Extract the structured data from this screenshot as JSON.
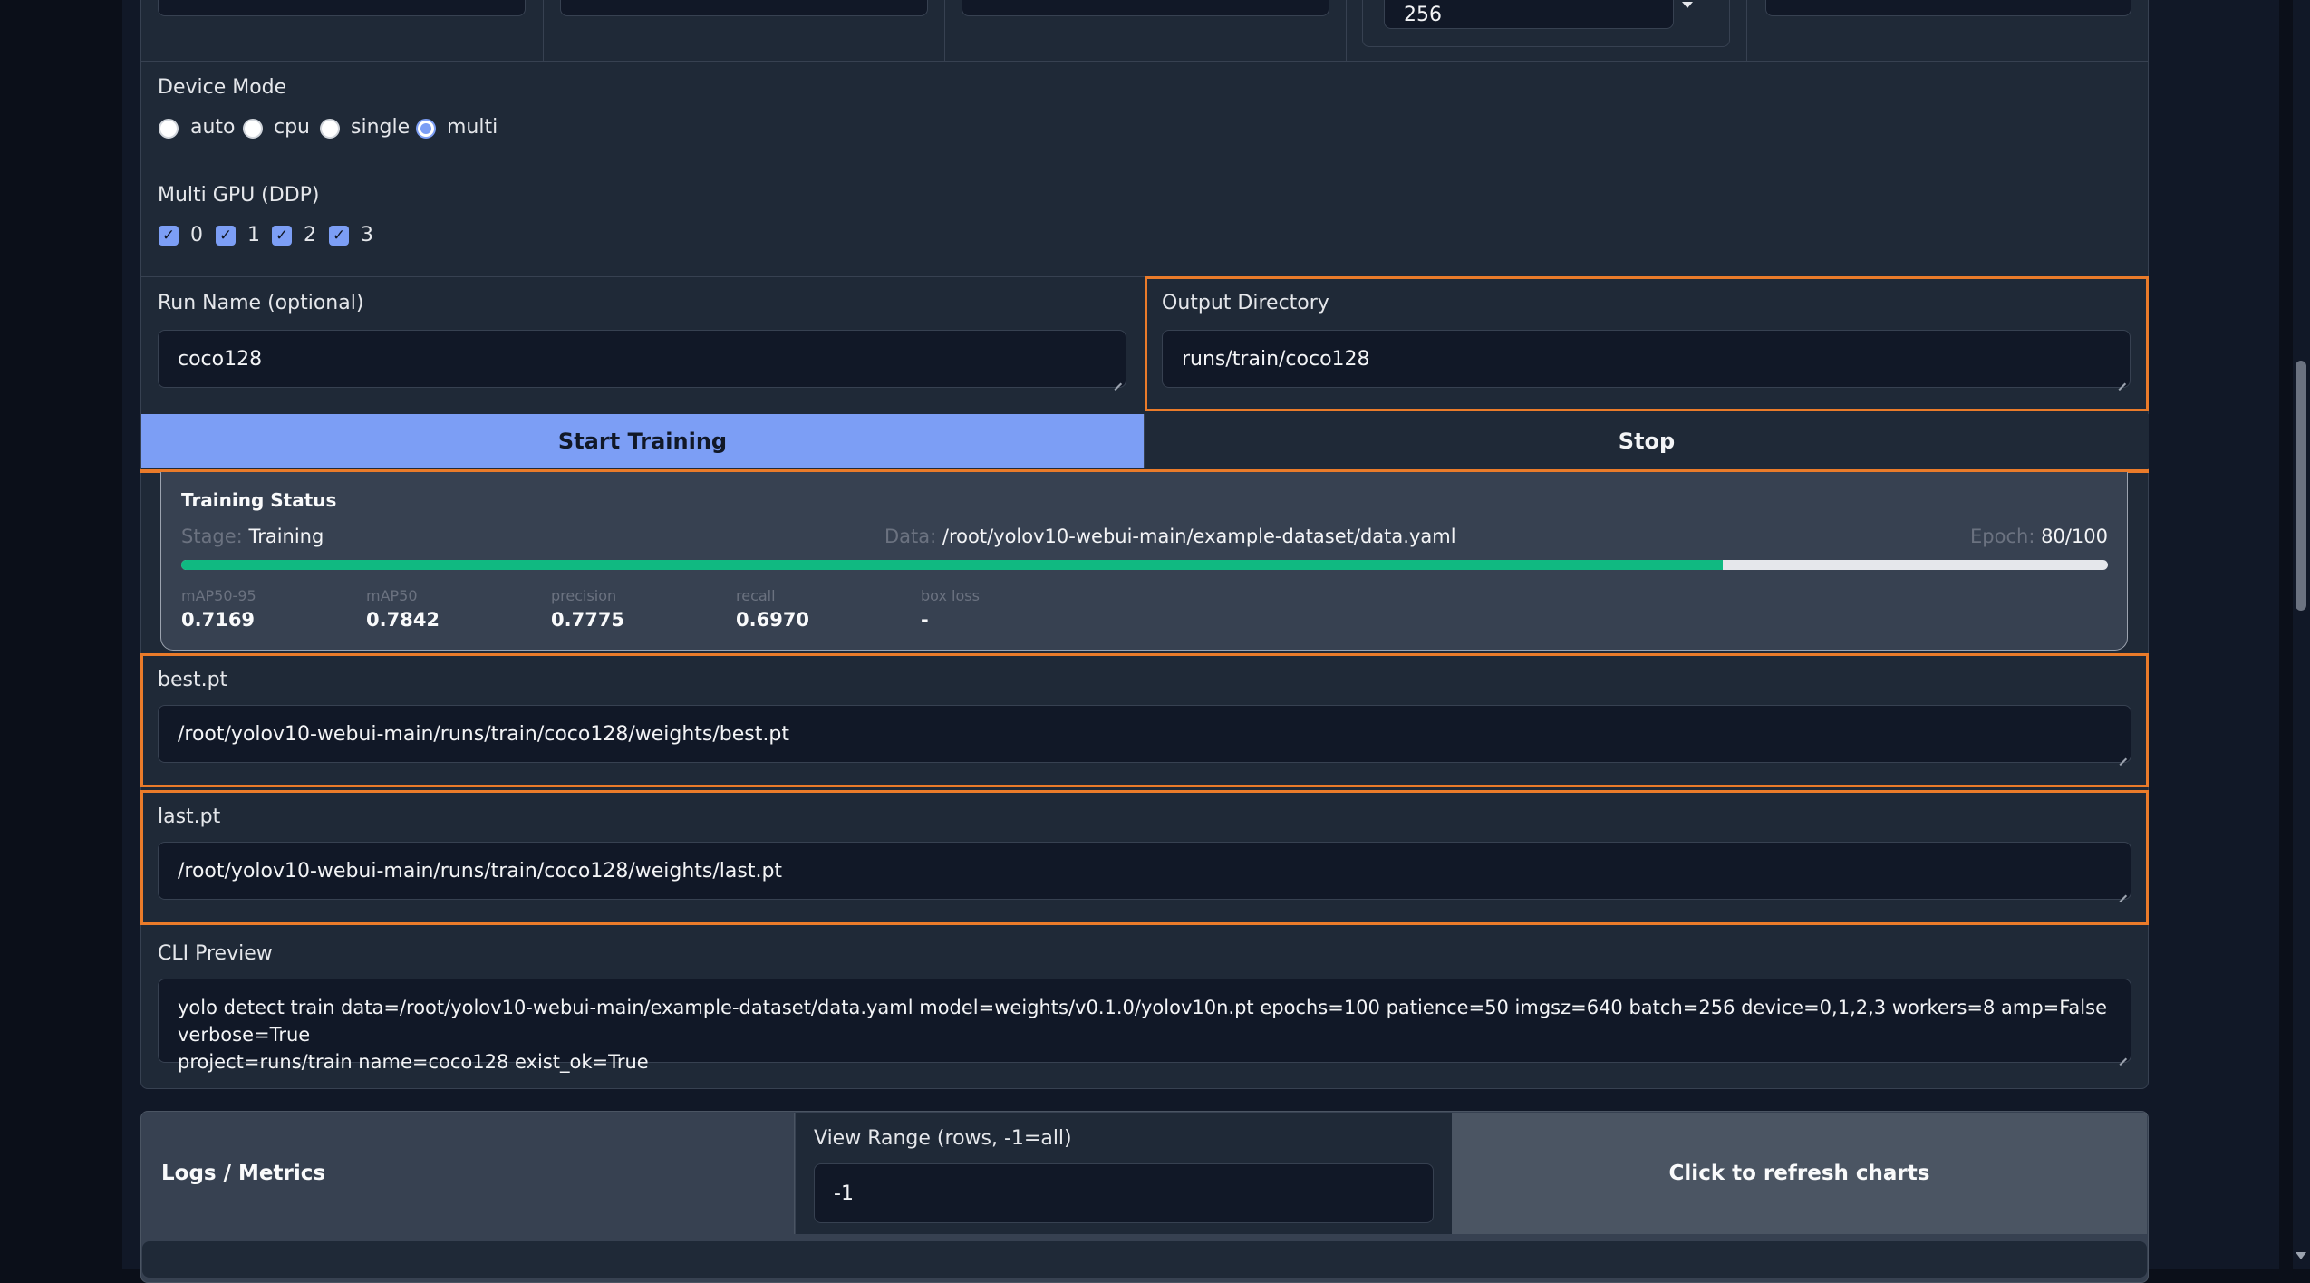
{
  "top_row": {
    "batch_value": "256"
  },
  "device_mode": {
    "label": "Device Mode",
    "options": [
      "auto",
      "cpu",
      "single",
      "multi"
    ],
    "selected": "multi"
  },
  "multi_gpu": {
    "label": "Multi GPU (DDP)",
    "options": [
      "0",
      "1",
      "2",
      "3"
    ]
  },
  "run_name": {
    "label": "Run Name (optional)",
    "value": "coco128"
  },
  "output_dir": {
    "label": "Output Directory",
    "value": "runs/train/coco128"
  },
  "buttons": {
    "start": "Start Training",
    "stop": "Stop"
  },
  "status": {
    "title": "Training Status",
    "stage_label": "Stage:",
    "stage_value": "Training",
    "data_label": "Data:",
    "data_value": "/root/yolov10-webui-main/example-dataset/data.yaml",
    "epoch_label": "Epoch:",
    "epoch_value": "80/100",
    "progress": 0.8,
    "metrics": [
      {
        "label": "mAP50-95",
        "value": "0.7169"
      },
      {
        "label": "mAP50",
        "value": "0.7842"
      },
      {
        "label": "precision",
        "value": "0.7775"
      },
      {
        "label": "recall",
        "value": "0.6970"
      },
      {
        "label": "box loss",
        "value": "-"
      }
    ]
  },
  "best_pt": {
    "label": "best.pt",
    "value": "/root/yolov10-webui-main/runs/train/coco128/weights/best.pt"
  },
  "last_pt": {
    "label": "last.pt",
    "value": "/root/yolov10-webui-main/runs/train/coco128/weights/last.pt"
  },
  "cli_preview": {
    "label": "CLI Preview",
    "line1": "yolo detect train data=/root/yolov10-webui-main/example-dataset/data.yaml model=weights/v0.1.0/yolov10n.pt epochs=100 patience=50 imgsz=640 batch=256 device=0,1,2,3 workers=8 amp=False verbose=True",
    "line2": "project=runs/train name=coco128 exist_ok=True"
  },
  "logs": {
    "title": "Logs / Metrics",
    "view_range_label": "View Range (rows, -1=all)",
    "view_range_value": "-1",
    "refresh_button": "Click to refresh charts"
  },
  "colors": {
    "accent": "#7c9ef5",
    "progress": "#10b981",
    "highlight": "#ea7b2a"
  }
}
